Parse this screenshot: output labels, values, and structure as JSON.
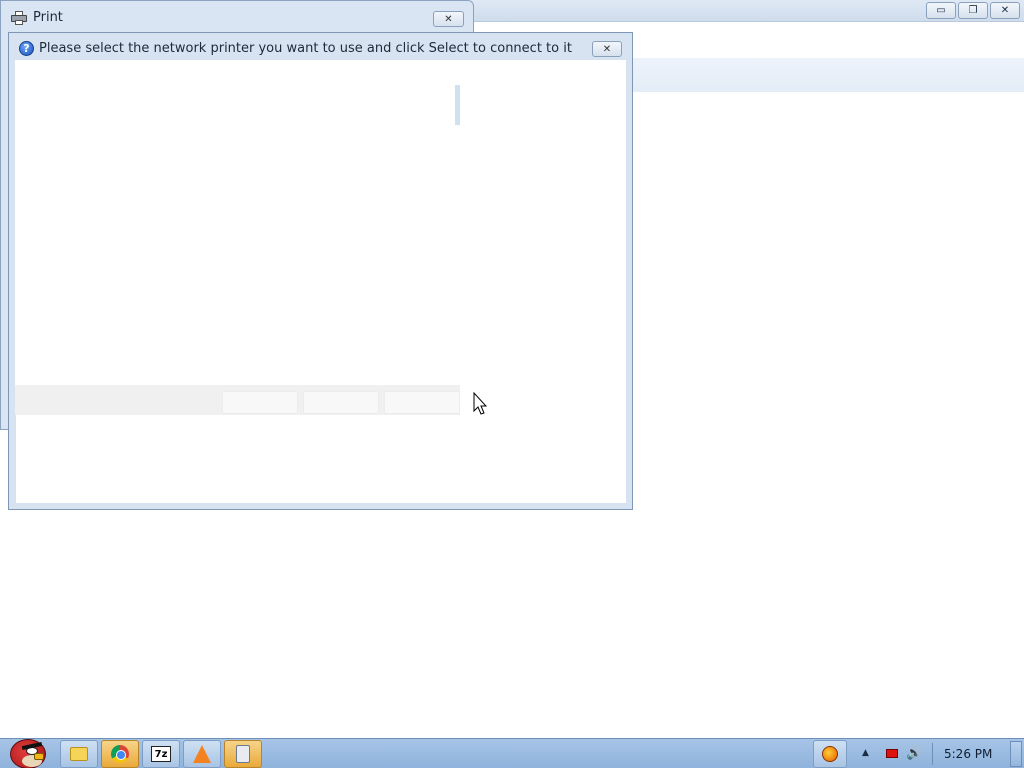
{
  "print_window": {
    "title": "Print",
    "close_glyph": "✕"
  },
  "network_dialog": {
    "title": "Please select the network printer you want to use and click Select to connect to it",
    "help_glyph": "?",
    "close_glyph": "✕"
  },
  "background_window": {
    "minimize_glyph": "▭",
    "restore_glyph": "❐",
    "close_glyph": "✕"
  },
  "taskbar": {
    "items": [
      {
        "name": "windows-explorer",
        "icon": "folder-icon"
      },
      {
        "name": "google-chrome",
        "icon": "chrome-icon"
      },
      {
        "name": "7zip",
        "icon": "7zip-icon",
        "glyph": "7z"
      },
      {
        "name": "vlc",
        "icon": "vlc-icon"
      },
      {
        "name": "calculator",
        "icon": "calculator-icon"
      }
    ],
    "tray": {
      "clock": "5:26 PM",
      "up_arrow": "▲",
      "volume_glyph": "🔊"
    }
  }
}
